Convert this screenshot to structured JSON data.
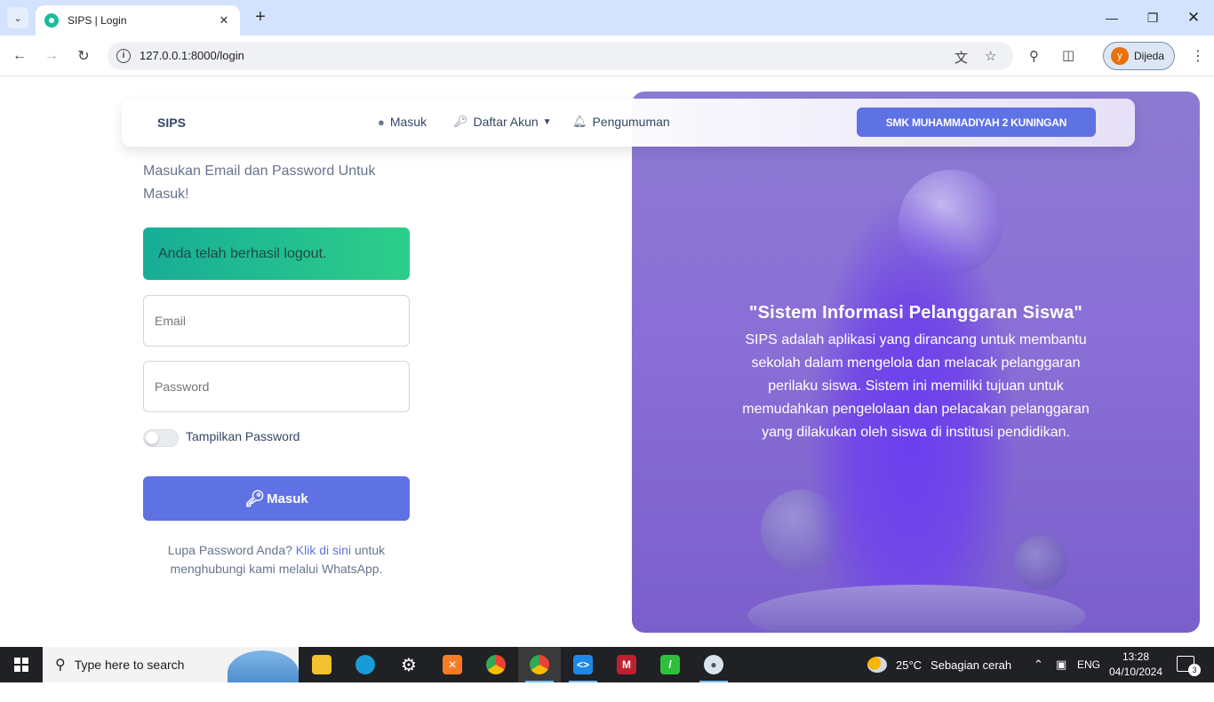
{
  "browser": {
    "tab_title": "SIPS | Login",
    "url": "127.0.0.1:8000/login",
    "profile_initial": "y",
    "profile_name": "Dijeda"
  },
  "navbar": {
    "brand": "SIPS",
    "items": [
      {
        "label": "Masuk",
        "icon": "user-circle-icon"
      },
      {
        "label": "Daftar Akun",
        "icon": "key-icon"
      },
      {
        "label": "Pengumuman",
        "icon": "bell-icon"
      }
    ],
    "school_button": "SMK MUHAMMADIYAH 2 KUNINGAN"
  },
  "login": {
    "lead": "Masukan Email dan Password Untuk Masuk!",
    "alert": "Anda telah berhasil logout.",
    "email_placeholder": "Email",
    "password_placeholder": "Password",
    "show_password_label": "Tampilkan Password",
    "submit_label": "Masuk",
    "forgot_prefix": "Lupa Password Anda?",
    "forgot_link": "Klik di sini",
    "forgot_suffix": "untuk menghubungi kami melalui WhatsApp."
  },
  "hero": {
    "title": "\"Sistem Informasi Pelanggaran Siswa\"",
    "description": "SIPS adalah aplikasi yang dirancang untuk membantu sekolah dalam mengelola dan melacak pelanggaran perilaku siswa. Sistem ini memiliki tujuan untuk memudahkan pengelolaan dan pelacakan pelanggaran yang dilakukan oleh siswa di institusi pendidikan."
  },
  "taskbar": {
    "search_placeholder": "Type here to search",
    "weather_temp": "25°C",
    "weather_text": "Sebagian cerah",
    "language": "ENG",
    "time": "13:28",
    "date": "04/10/2024",
    "notification_count": "3"
  },
  "colors": {
    "primary": "#5e72e4",
    "success_from": "#17ad97",
    "success_to": "#2dce89",
    "hero_purple": "#8a6fd6",
    "text_dark": "#344767",
    "text_muted": "#67748e"
  }
}
